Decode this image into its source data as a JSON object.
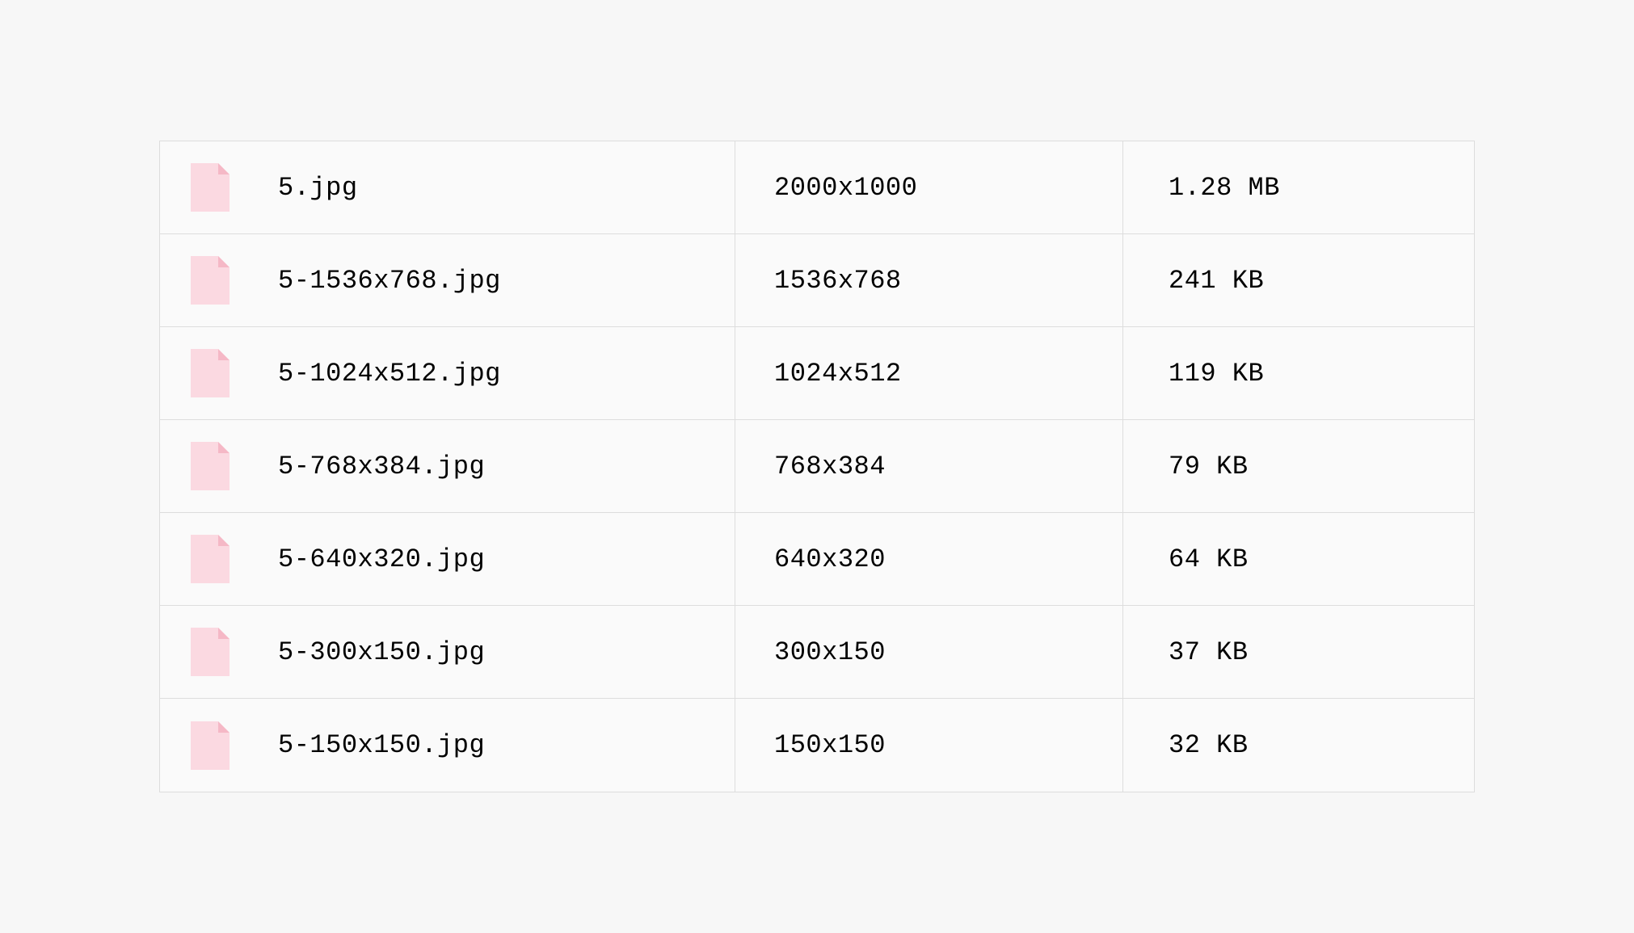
{
  "icon_colors": {
    "body": "#fbd9e1",
    "fold": "#f5b8c6"
  },
  "files": [
    {
      "name": "5.jpg",
      "dimensions": "2000x1000",
      "size": "1.28 MB"
    },
    {
      "name": "5-1536x768.jpg",
      "dimensions": "1536x768",
      "size": "241 KB"
    },
    {
      "name": "5-1024x512.jpg",
      "dimensions": "1024x512",
      "size": "119 KB"
    },
    {
      "name": "5-768x384.jpg",
      "dimensions": "768x384",
      "size": "79 KB"
    },
    {
      "name": "5-640x320.jpg",
      "dimensions": "640x320",
      "size": "64 KB"
    },
    {
      "name": "5-300x150.jpg",
      "dimensions": "300x150",
      "size": "37 KB"
    },
    {
      "name": "5-150x150.jpg",
      "dimensions": "150x150",
      "size": "32 KB"
    }
  ]
}
